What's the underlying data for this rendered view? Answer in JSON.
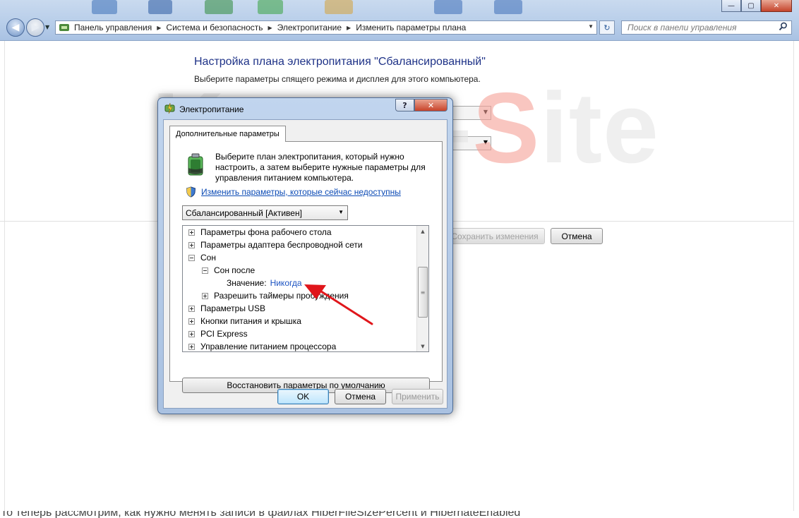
{
  "window": {
    "minimize_glyph": "—",
    "maximize_glyph": "▢",
    "close_glyph": "✕"
  },
  "nav": {
    "back_glyph": "◀",
    "forward_glyph": "▶",
    "history_glyph": "▼",
    "refresh_glyph": "↻"
  },
  "address": {
    "crumbs": [
      "Панель управления",
      "Система и безопасность",
      "Электропитание",
      "Изменить параметры плана"
    ],
    "sep": "▶",
    "drop": "▼"
  },
  "search": {
    "placeholder": "Поиск в панели управления",
    "icon": "search-icon"
  },
  "page": {
    "title": "Настройка плана электропитания \"Сбалансированный\"",
    "subtitle": "Выберите параметры спящего режима и дисплея для этого компьютера.",
    "save_button": "Сохранить изменения",
    "cancel_button": "Отмена",
    "combo_arrow": "▼"
  },
  "watermark": {
    "prefix": "Komp-",
    "accent": "S",
    "suffix": "ite"
  },
  "caption": "то теперь рассмотрим, как нужно менять записи в файлах HiberFileSizePercent и HibernateEnabled",
  "dialog": {
    "title": "Электропитание",
    "help": "?",
    "close": "✕",
    "tab": "Дополнительные параметры",
    "intro": "Выберите план электропитания, который нужно настроить, а затем выберите нужные параметры для управления питанием компьютера.",
    "link": "Изменить параметры, которые сейчас недоступны",
    "plan": "Сбалансированный [Активен]",
    "plan_arrow": "▼",
    "tree": [
      {
        "label": "Параметры фона рабочего стола",
        "state": "plus"
      },
      {
        "label": "Параметры адаптера беспроводной сети",
        "state": "plus"
      },
      {
        "label": "Сон",
        "state": "minus"
      },
      {
        "label": "Сон после",
        "state": "minus"
      },
      {
        "label": "Значение:",
        "value": "Никогда"
      },
      {
        "label": "Разрешить таймеры пробуждения",
        "state": "plus"
      },
      {
        "label": "Параметры USB",
        "state": "plus"
      },
      {
        "label": "Кнопки питания и крышка",
        "state": "plus"
      },
      {
        "label": "PCI Express",
        "state": "plus"
      },
      {
        "label": "Управление питанием процессора",
        "state": "plus"
      }
    ],
    "scroll_up": "▲",
    "scroll_down": "▼",
    "scroll_grip": "≡",
    "restore": "Восстановить параметры по умолчанию",
    "ok": "OK",
    "cancel": "Отмена",
    "apply": "Применить"
  },
  "colors": {
    "link": "#0c4bb5",
    "title": "#1e3287",
    "annotation_arrow": "#e0161b"
  }
}
